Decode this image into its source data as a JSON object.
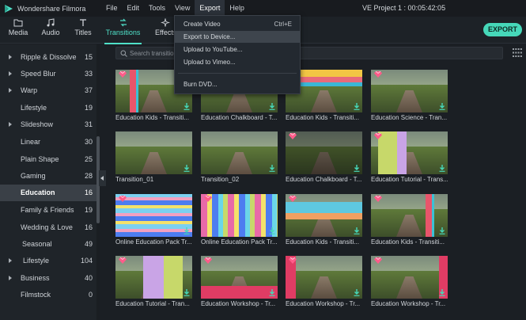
{
  "app": {
    "name": "Wondershare Filmora",
    "project": "VE Project 1 : 00:05:42:05"
  },
  "menu": [
    "File",
    "Edit",
    "Tools",
    "View",
    "Export",
    "Help"
  ],
  "toolbar": {
    "tabs": [
      "Media",
      "Audio",
      "Titles",
      "Transitions",
      "Effects"
    ],
    "export_label": "EXPORT"
  },
  "export_menu": {
    "items": [
      {
        "label": "Create Video",
        "shortcut": "Ctrl+E"
      },
      {
        "label": "Export to Device...",
        "shortcut": ""
      },
      {
        "label": "Upload to YouTube...",
        "shortcut": ""
      },
      {
        "label": "Upload to Vimeo...",
        "shortcut": ""
      },
      {
        "label": "Burn DVD...",
        "shortcut": ""
      }
    ]
  },
  "sidebar": {
    "items": [
      {
        "label": "Ripple & Dissolve",
        "count": "15",
        "arrow": true
      },
      {
        "label": "Speed Blur",
        "count": "33",
        "arrow": true
      },
      {
        "label": "Warp",
        "count": "37",
        "arrow": true
      },
      {
        "label": "Lifestyle",
        "count": "19",
        "arrow": false
      },
      {
        "label": "Slideshow",
        "count": "31",
        "arrow": true
      },
      {
        "label": "Linear",
        "count": "30",
        "arrow": false
      },
      {
        "label": "Plain Shape",
        "count": "25",
        "arrow": false
      },
      {
        "label": "Gaming",
        "count": "28",
        "arrow": false
      },
      {
        "label": "Education",
        "count": "16",
        "arrow": false,
        "selected": true
      },
      {
        "label": "Family & Friends",
        "count": "19",
        "arrow": false
      },
      {
        "label": "Wedding & Love",
        "count": "16",
        "arrow": false
      },
      {
        "label": "Seasonal",
        "count": "49",
        "arrow": false
      },
      {
        "label": "Lifestyle",
        "count": "104",
        "arrow": true
      },
      {
        "label": "Business",
        "count": "40",
        "arrow": true
      },
      {
        "label": "Filmstock",
        "count": "0",
        "arrow": false
      }
    ]
  },
  "search": {
    "placeholder": "Search transitions"
  },
  "transitions": [
    {
      "caption": "Education Kids - Transiti...",
      "premium": true,
      "style": "kids1"
    },
    {
      "caption": "Education Chalkboard - T...",
      "premium": true,
      "style": "chalk"
    },
    {
      "caption": "Education Kids - Transiti...",
      "premium": true,
      "style": "kids2"
    },
    {
      "caption": "Education Science - Tran...",
      "premium": true,
      "style": "science"
    },
    {
      "caption": "Transition_01",
      "premium": false,
      "style": "plain"
    },
    {
      "caption": "Transition_02",
      "premium": false,
      "style": "plain"
    },
    {
      "caption": "Education Chalkboard - T...",
      "premium": true,
      "style": "chalk2"
    },
    {
      "caption": "Education Tutorial - Trans...",
      "premium": true,
      "style": "tutorial"
    },
    {
      "caption": "Online Education Pack Tr...",
      "premium": true,
      "style": "online1"
    },
    {
      "caption": "Online Education Pack Tr...",
      "premium": true,
      "style": "online2"
    },
    {
      "caption": "Education Kids - Transiti...",
      "premium": true,
      "style": "kids3"
    },
    {
      "caption": "Education Kids - Transiti...",
      "premium": true,
      "style": "kids4"
    },
    {
      "caption": "Education Tutorial - Tran...",
      "premium": true,
      "style": "tutorial2"
    },
    {
      "caption": "Education Workshop - Tr...",
      "premium": true,
      "style": "workshop1"
    },
    {
      "caption": "Education Workshop - Tr...",
      "premium": true,
      "style": "workshop2"
    },
    {
      "caption": "Education Workshop - Tr...",
      "premium": true,
      "style": "workshop3"
    }
  ],
  "colors": {
    "accent": "#46d8b9",
    "premium": "#ff5c8a"
  }
}
